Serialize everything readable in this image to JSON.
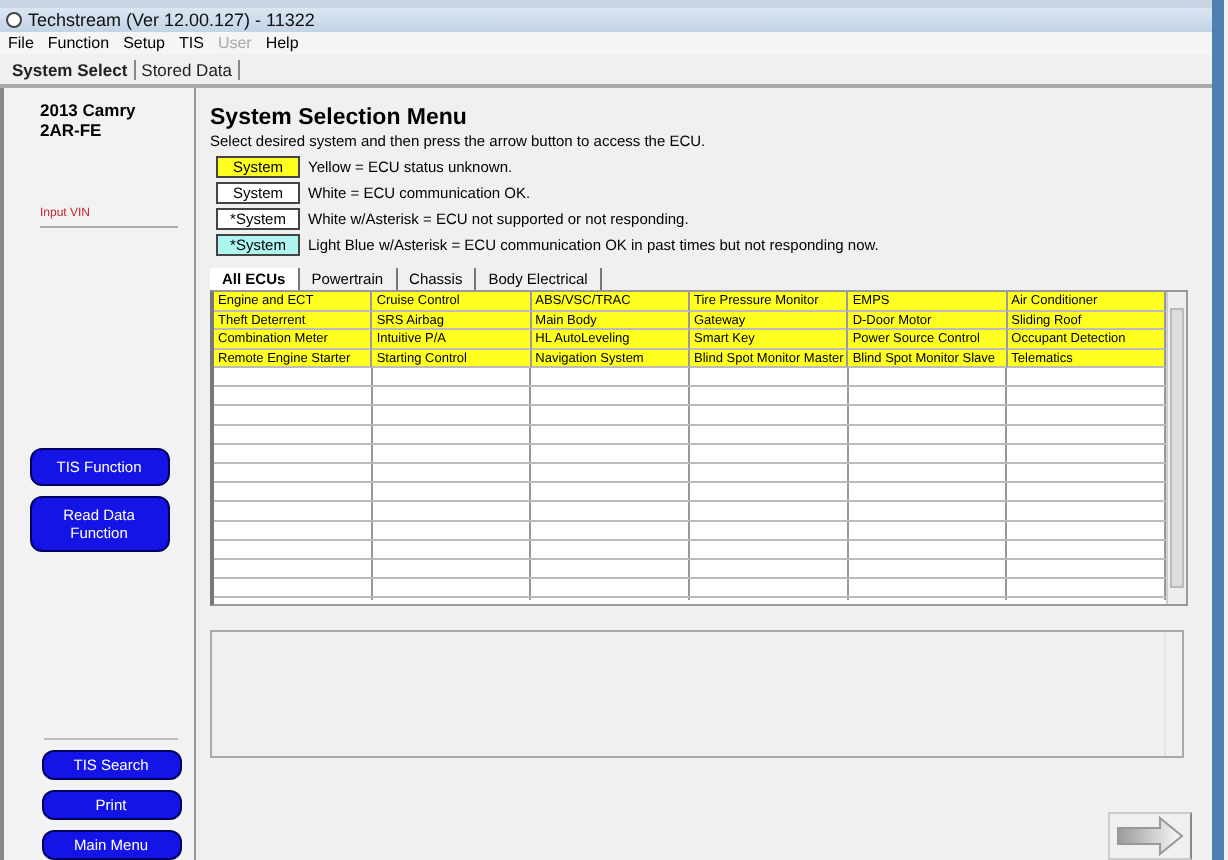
{
  "window": {
    "title": "Techstream (Ver 12.00.127) - 11322"
  },
  "menu_items": [
    {
      "label": "File",
      "disabled": false
    },
    {
      "label": "Function",
      "disabled": false
    },
    {
      "label": "Setup",
      "disabled": false
    },
    {
      "label": "TIS",
      "disabled": false
    },
    {
      "label": "User",
      "disabled": true
    },
    {
      "label": "Help",
      "disabled": false
    }
  ],
  "tabs": [
    {
      "label": "System Select",
      "selected": true
    },
    {
      "label": "Stored Data",
      "selected": false
    }
  ],
  "sidebar": {
    "vehicle": [
      "2013 Camry",
      "2AR-FE"
    ],
    "vin_label": "Input VIN",
    "top_buttons": [
      "TIS Function",
      "Read Data Function"
    ],
    "bottom_buttons": [
      "TIS Search",
      "Print",
      "Main Menu"
    ]
  },
  "main": {
    "title": "System Selection Menu",
    "instruction": "Select desired system and then press the arrow button to access the ECU.",
    "legend": [
      {
        "sample": "System",
        "kind": "yellow",
        "text": "Yellow = ECU status unknown."
      },
      {
        "sample": "System",
        "kind": "white",
        "text": "White = ECU communication OK."
      },
      {
        "sample": "*System",
        "kind": "white",
        "text": "White w/Asterisk = ECU not supported or not responding."
      },
      {
        "sample": "*System",
        "kind": "lightblue",
        "text": "Light Blue w/Asterisk = ECU communication OK in past times but not responding now."
      }
    ],
    "ecu_tabs": [
      {
        "label": "All ECUs",
        "selected": true
      },
      {
        "label": "Powertrain",
        "selected": false
      },
      {
        "label": "Chassis",
        "selected": false
      },
      {
        "label": "Body Electrical",
        "selected": false
      }
    ],
    "ecu_rows": [
      [
        {
          "name": "Engine and ECT",
          "kind": "yellow"
        },
        {
          "name": "Cruise Control",
          "kind": "yellow"
        },
        {
          "name": "ABS/VSC/TRAC",
          "kind": "yellow"
        },
        {
          "name": "Tire Pressure Monitor",
          "kind": "yellow"
        },
        {
          "name": "EMPS",
          "kind": "yellow"
        },
        {
          "name": "Air Conditioner",
          "kind": "yellow"
        }
      ],
      [
        {
          "name": "Theft Deterrent",
          "kind": "yellow"
        },
        {
          "name": "SRS Airbag",
          "kind": "yellow"
        },
        {
          "name": "Main Body",
          "kind": "yellow"
        },
        {
          "name": "Gateway",
          "kind": "yellow"
        },
        {
          "name": "D-Door Motor",
          "kind": "yellow"
        },
        {
          "name": "Sliding Roof",
          "kind": "yellow"
        }
      ],
      [
        {
          "name": "Combination Meter",
          "kind": "yellow"
        },
        {
          "name": "Intuitive P/A",
          "kind": "yellow"
        },
        {
          "name": "HL AutoLeveling",
          "kind": "yellow"
        },
        {
          "name": "Smart Key",
          "kind": "yellow"
        },
        {
          "name": "Power Source Control",
          "kind": "yellow"
        },
        {
          "name": "Occupant Detection",
          "kind": "yellow"
        }
      ],
      [
        {
          "name": "Remote Engine Starter",
          "kind": "yellow"
        },
        {
          "name": "Starting Control",
          "kind": "yellow"
        },
        {
          "name": "Navigation System",
          "kind": "yellow"
        },
        {
          "name": "Blind Spot Monitor Master",
          "kind": "yellow"
        },
        {
          "name": "Blind Spot Monitor Slave",
          "kind": "yellow"
        },
        {
          "name": "Telematics",
          "kind": "yellow"
        }
      ]
    ]
  }
}
